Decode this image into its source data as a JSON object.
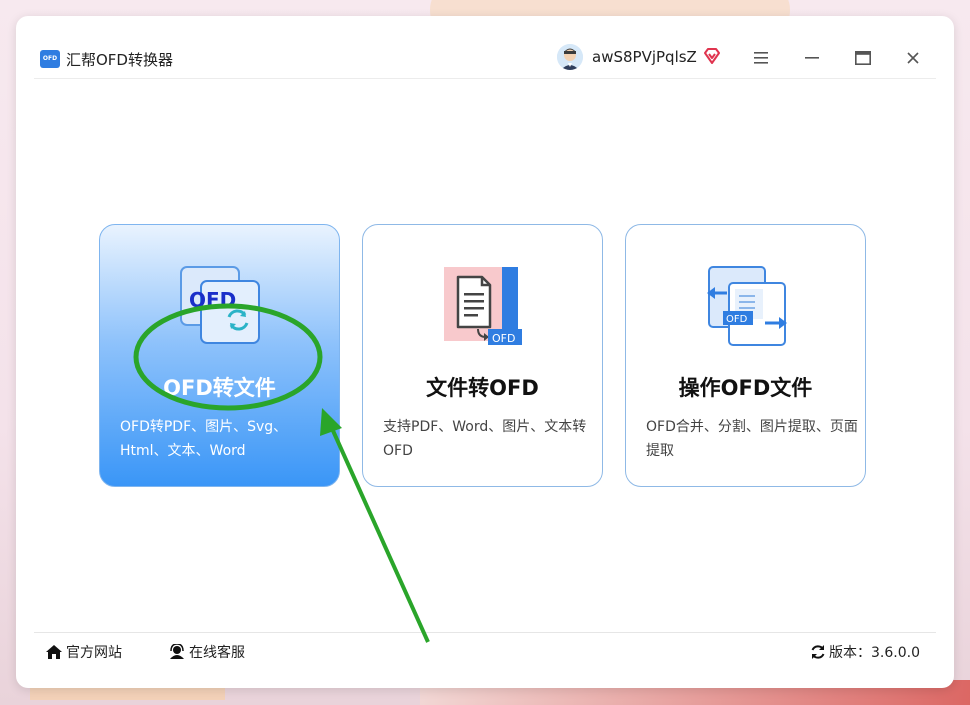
{
  "app": {
    "title": "汇帮OFD转换器",
    "logo_text": "OFD"
  },
  "user": {
    "name": "awS8PVjPqlsZ",
    "vip_icon": "vip-diamond-icon"
  },
  "window_controls": [
    "menu-icon",
    "minimize-icon",
    "maximize-icon",
    "close-icon"
  ],
  "cards": [
    {
      "title": "OFD转文件",
      "desc": "OFD转PDF、图片、Svg、Html、文本、Word",
      "icon_label": "OFD",
      "active": true
    },
    {
      "title": "文件转OFD",
      "desc": "支持PDF、Word、图片、文本转OFD",
      "icon_label": "OFD",
      "active": false
    },
    {
      "title": "操作OFD文件",
      "desc": "OFD合并、分割、图片提取、页面提取",
      "icon_label": "OFD",
      "active": false
    }
  ],
  "footer": {
    "website": "官方网站",
    "support": "在线客服",
    "version": "版本：3.6.0.0"
  },
  "colors": {
    "accent": "#3a96f7",
    "annotation": "#2aa52a"
  }
}
